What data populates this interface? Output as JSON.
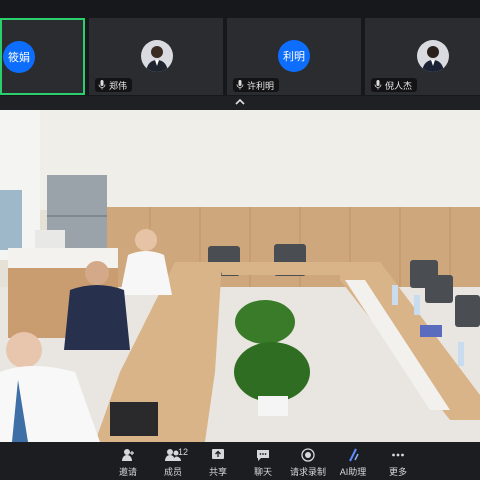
{
  "participants": [
    {
      "name": "筱娟",
      "avatar_text": "筱娟",
      "type": "initials",
      "active": true
    },
    {
      "name": "郑伟",
      "type": "photo",
      "active": false
    },
    {
      "name": "许利明",
      "avatar_text": "利明",
      "type": "initials",
      "active": false
    },
    {
      "name": "倪人杰",
      "type": "photo",
      "active": false
    }
  ],
  "toolbar": {
    "invite": "邀请",
    "members": "成员",
    "member_count": "12",
    "share": "共享",
    "chat": "聊天",
    "record": "请求录制",
    "ai": "AI助理",
    "more": "更多"
  },
  "colors": {
    "accent_green": "#2bd06c",
    "avatar_blue": "#0d6efd"
  }
}
